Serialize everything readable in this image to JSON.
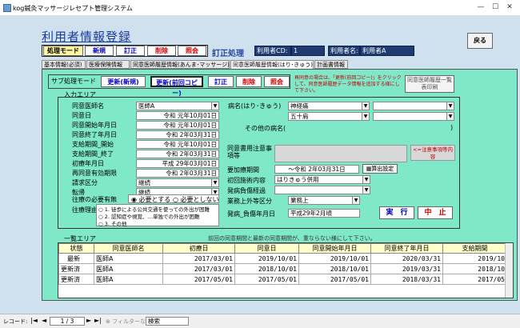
{
  "window": {
    "title": "kog鍼灸マッサージレセプト管理システム"
  },
  "page": {
    "title": "利用者情報登録",
    "back": "戻る"
  },
  "mode": {
    "label": "処理モード",
    "new": "新規",
    "edit": "訂正",
    "delete": "削除",
    "view": "照会",
    "current": "訂正処理"
  },
  "user": {
    "cd_label": "利用者CD:",
    "cd_value": "1",
    "name_label": "利用者名:",
    "name_value": "利用者A"
  },
  "tabs": [
    "基本情報(必須)",
    "医療保険情報",
    "同意医師履歴情報(あんま･マッサージ)",
    "同意医師履歴情報(はり･きゅう)",
    "計画書情報"
  ],
  "sub": {
    "label": "サブ処理モード",
    "new": "更新(新規)",
    "copy": "更新(前回コピー)",
    "edit": "訂正",
    "delete": "削除",
    "view": "照会",
    "hint": "再同意の場合は、「更新(前回コピー)」をクリックして、同意医師履歴データ情報を追加する様にして下さい。",
    "history": "同意医師履歴一覧表印刷"
  },
  "input": {
    "area": "入力エリア",
    "doctor_label": "同意医師名",
    "doctor": "医師A",
    "consent_date_label": "同意日",
    "consent_date": "令和 元年10月01日",
    "start_label": "同意開始年月日",
    "start": "令和 元年10月01日",
    "end_label": "同意終了年月日",
    "end": "令和 2年03月31日",
    "pay_start_label": "支給期間_開始",
    "pay_start": "令和 元年10月01日",
    "pay_end_label": "支給期間_終了",
    "pay_end": "令和 2年03月31日",
    "first_label": "初療年月日",
    "first": "平成 29年03月01日",
    "reconsent_label": "再同意有効期限",
    "reconsent": "令和 2年03月31日",
    "claim_label": "請求区分",
    "claim": "継続",
    "transfer_label": "転帰",
    "transfer": "継続",
    "visit_label": "往療の必要有無",
    "visit_yes": "必要とする",
    "visit_no": "必要としない",
    "reason_label": "往療理由",
    "reasons": [
      "1. 徒歩による公共交通を使っての外出が困難",
      "2. 認知症や視覚、…単独での外出が困難",
      "3. その他"
    ],
    "disease_label": "病名(はり･きゅう)",
    "disease1": "神経痛",
    "disease2": "五十肩",
    "other_label": "その他の病名(",
    "notes_label": "同意書用注意事項等",
    "notes_hint": "<=注意事項等内容",
    "plan_label": "要加療期間",
    "plan": "～令和 2年03月31日",
    "calc": "算出設定",
    "first_content_label": "初回施術内容",
    "first_content": "はりきゅう併用",
    "onset_label": "発病負傷経過",
    "onset": "",
    "work_label": "業務上外等区分",
    "work": "業務上",
    "onset_date_label": "発病_負傷年月日",
    "onset_date": "平成29年2月頃",
    "run": "実　行",
    "cancel": "中　止"
  },
  "list": {
    "area": "一覧エリア",
    "notice": "前回の同意期間と最新の同意期間が、重ならない様にして下さい。",
    "headers": [
      "状態",
      "同意医師名",
      "初療日",
      "同意日",
      "同意開始年月日",
      "同意終了年月日",
      "支給期間"
    ],
    "rows": [
      [
        "最新",
        "医師A",
        "2017/03/01",
        "2019/10/01",
        "2019/10/01",
        "2020/03/31",
        "2019/10"
      ],
      [
        "更新済",
        "医師A",
        "2017/03/01",
        "2018/10/01",
        "2018/10/01",
        "2019/03/31",
        "2018/10"
      ],
      [
        "更新済",
        "医師A",
        "2017/05/01",
        "2017/05/01",
        "2017/05/01",
        "2018/03/31",
        "2017/05"
      ]
    ]
  },
  "status": {
    "record_label": "レコード:",
    "record": "1 / 3",
    "filter": "フィルターなし",
    "search": "検索"
  }
}
